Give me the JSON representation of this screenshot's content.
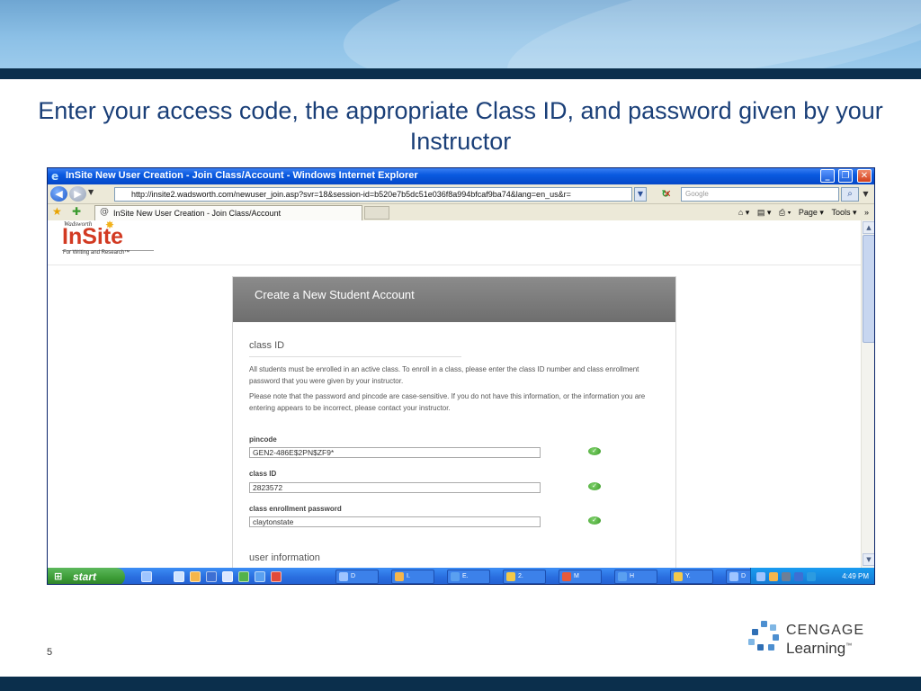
{
  "slide": {
    "title": "Enter your access code,  the appropriate Class ID, and password given by your Instructor",
    "page_number": "5",
    "brand": {
      "name": "CENGAGE",
      "sub": "Learning",
      "tm": "™"
    },
    "colors": {
      "title": "#1a3f78",
      "band_dark": "#0b2f4c",
      "band_light": "#8cc0e6"
    }
  },
  "browser": {
    "window_title": "InSite New User Creation - Join Class/Account - Windows Internet Explorer",
    "url": "http://insite2.wadsworth.com/newuser_join.asp?svr=18&session-id=b520e7b5dc51e036f8a994bfcaf9ba74&lang=en_us&r=",
    "search_placeholder": "Google",
    "tab_label": "InSite New User Creation - Join Class/Account",
    "commands": {
      "page": "Page ▾",
      "tools": "Tools ▾",
      "more": "»"
    },
    "icons": {
      "back": "back-arrow-icon",
      "forward": "forward-arrow-icon",
      "refresh": "refresh-icon",
      "stop": "stop-icon",
      "search": "magnifier-icon",
      "favorites": "favorites-star-icon",
      "add_favorite": "add-favorite-icon",
      "home": "home-icon",
      "print": "printer-icon"
    }
  },
  "site": {
    "publisher": "Wadsworth",
    "logo": "InSite",
    "tagline": "For Writing and Research™",
    "form": {
      "header": "Create a New Student Account",
      "section_class": "class ID",
      "paragraph_1": "All students must be enrolled in an active class. To enroll in a class, please enter the class ID number and class enrollment password that you were given by your instructor.",
      "paragraph_2": "Please note that the password and pincode are case-sensitive. If you do not have this information, or the information you are entering appears to be incorrect, please contact your instructor.",
      "fields": [
        {
          "label": "pincode",
          "value": "GEN2-486E$2PN$ZF9*",
          "valid": true
        },
        {
          "label": "class ID",
          "value": "2823572",
          "valid": true
        },
        {
          "label": "class enrollment password",
          "value": "claytonstate",
          "valid": true
        }
      ],
      "section_user": "user information",
      "accent": "#d23a22"
    }
  },
  "taskbar": {
    "start_label": "start",
    "clock": "4:49 PM",
    "buttons": [
      {
        "label": "D",
        "color": "#9ec4ff"
      },
      {
        "label": "I.",
        "color": "#f6b64b"
      },
      {
        "label": "E.",
        "color": "#5aa0f0"
      },
      {
        "label": "2.",
        "color": "#f3c94a"
      },
      {
        "label": "M",
        "color": "#e65a3a"
      },
      {
        "label": "H",
        "color": "#5aa0f0"
      },
      {
        "label": "Y.",
        "color": "#f3c94a"
      },
      {
        "label": "D",
        "color": "#9ec4ff"
      },
      {
        "label": "I.",
        "color": "#5aa0f0",
        "active": true
      }
    ]
  }
}
